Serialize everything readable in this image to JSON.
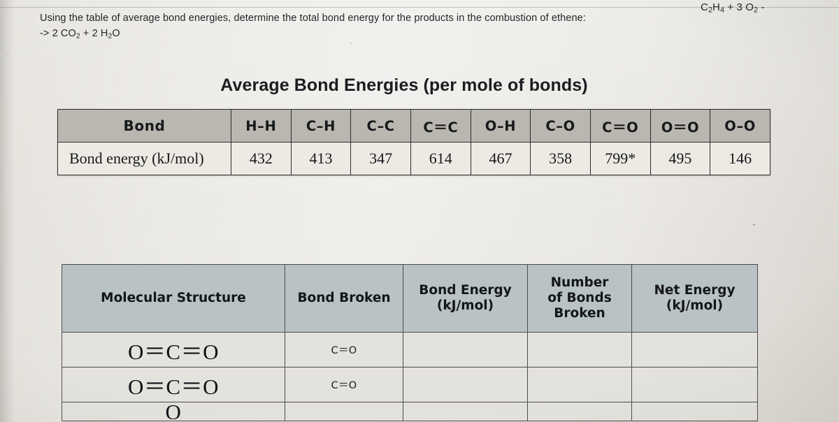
{
  "question": {
    "line1": "Using the table of average bond energies, determine the total bond energy for the products in the combustion of ethene:",
    "line2_prefix": "->",
    "line2": "2 CO",
    "line2_sub1": "2",
    "line2_mid": " + 2 H",
    "line2_sub2": "2",
    "line2_end": "O",
    "equation_right": "C2H4 + 3 O2 -",
    "equation_right_parts": {
      "c": "C",
      "c_sub": "2",
      "h": "H",
      "h_sub": "4",
      "plus": " + 3 ",
      "o": "O",
      "o_sub": "2",
      "dash": " -"
    }
  },
  "bond_table": {
    "title": "Average Bond Energies (per mole of bonds)",
    "row_labels": [
      "Bond",
      "Bond energy (kJ/mol)"
    ],
    "bonds": [
      "H–H",
      "C–H",
      "C–C",
      "C＝C",
      "O–H",
      "C–O",
      "C＝O",
      "O＝O",
      "O–O"
    ],
    "energies": [
      "432",
      "413",
      "347",
      "614",
      "467",
      "358",
      "799*",
      "495",
      "146"
    ]
  },
  "work_table": {
    "headers": {
      "structure": "Molecular Structure",
      "bond_broken": "Bond Broken",
      "bond_energy_l1": "Bond Energy",
      "bond_energy_l2": "(kJ/mol)",
      "number_l1": "Number",
      "number_l2": "of Bonds",
      "number_l3": "Broken",
      "net_energy_l1": "Net Energy",
      "net_energy_l2": "(kJ/mol)"
    },
    "rows": [
      {
        "structure": "O＝C＝O",
        "bond_broken": "C＝O",
        "bond_energy": "",
        "number": "",
        "net_energy": ""
      },
      {
        "structure": "O＝C＝O",
        "bond_broken": "C＝O",
        "bond_energy": "",
        "number": "",
        "net_energy": ""
      },
      {
        "structure": "O",
        "bond_broken": "",
        "bond_energy": "",
        "number": "",
        "net_energy": ""
      }
    ]
  },
  "colors": {
    "page_background": "#e8e5df",
    "bond_header_fill": "#b9b7b0",
    "work_header_fill": "#b9c2c4",
    "cell_fill": "#edeae4",
    "text": "#17191b"
  }
}
